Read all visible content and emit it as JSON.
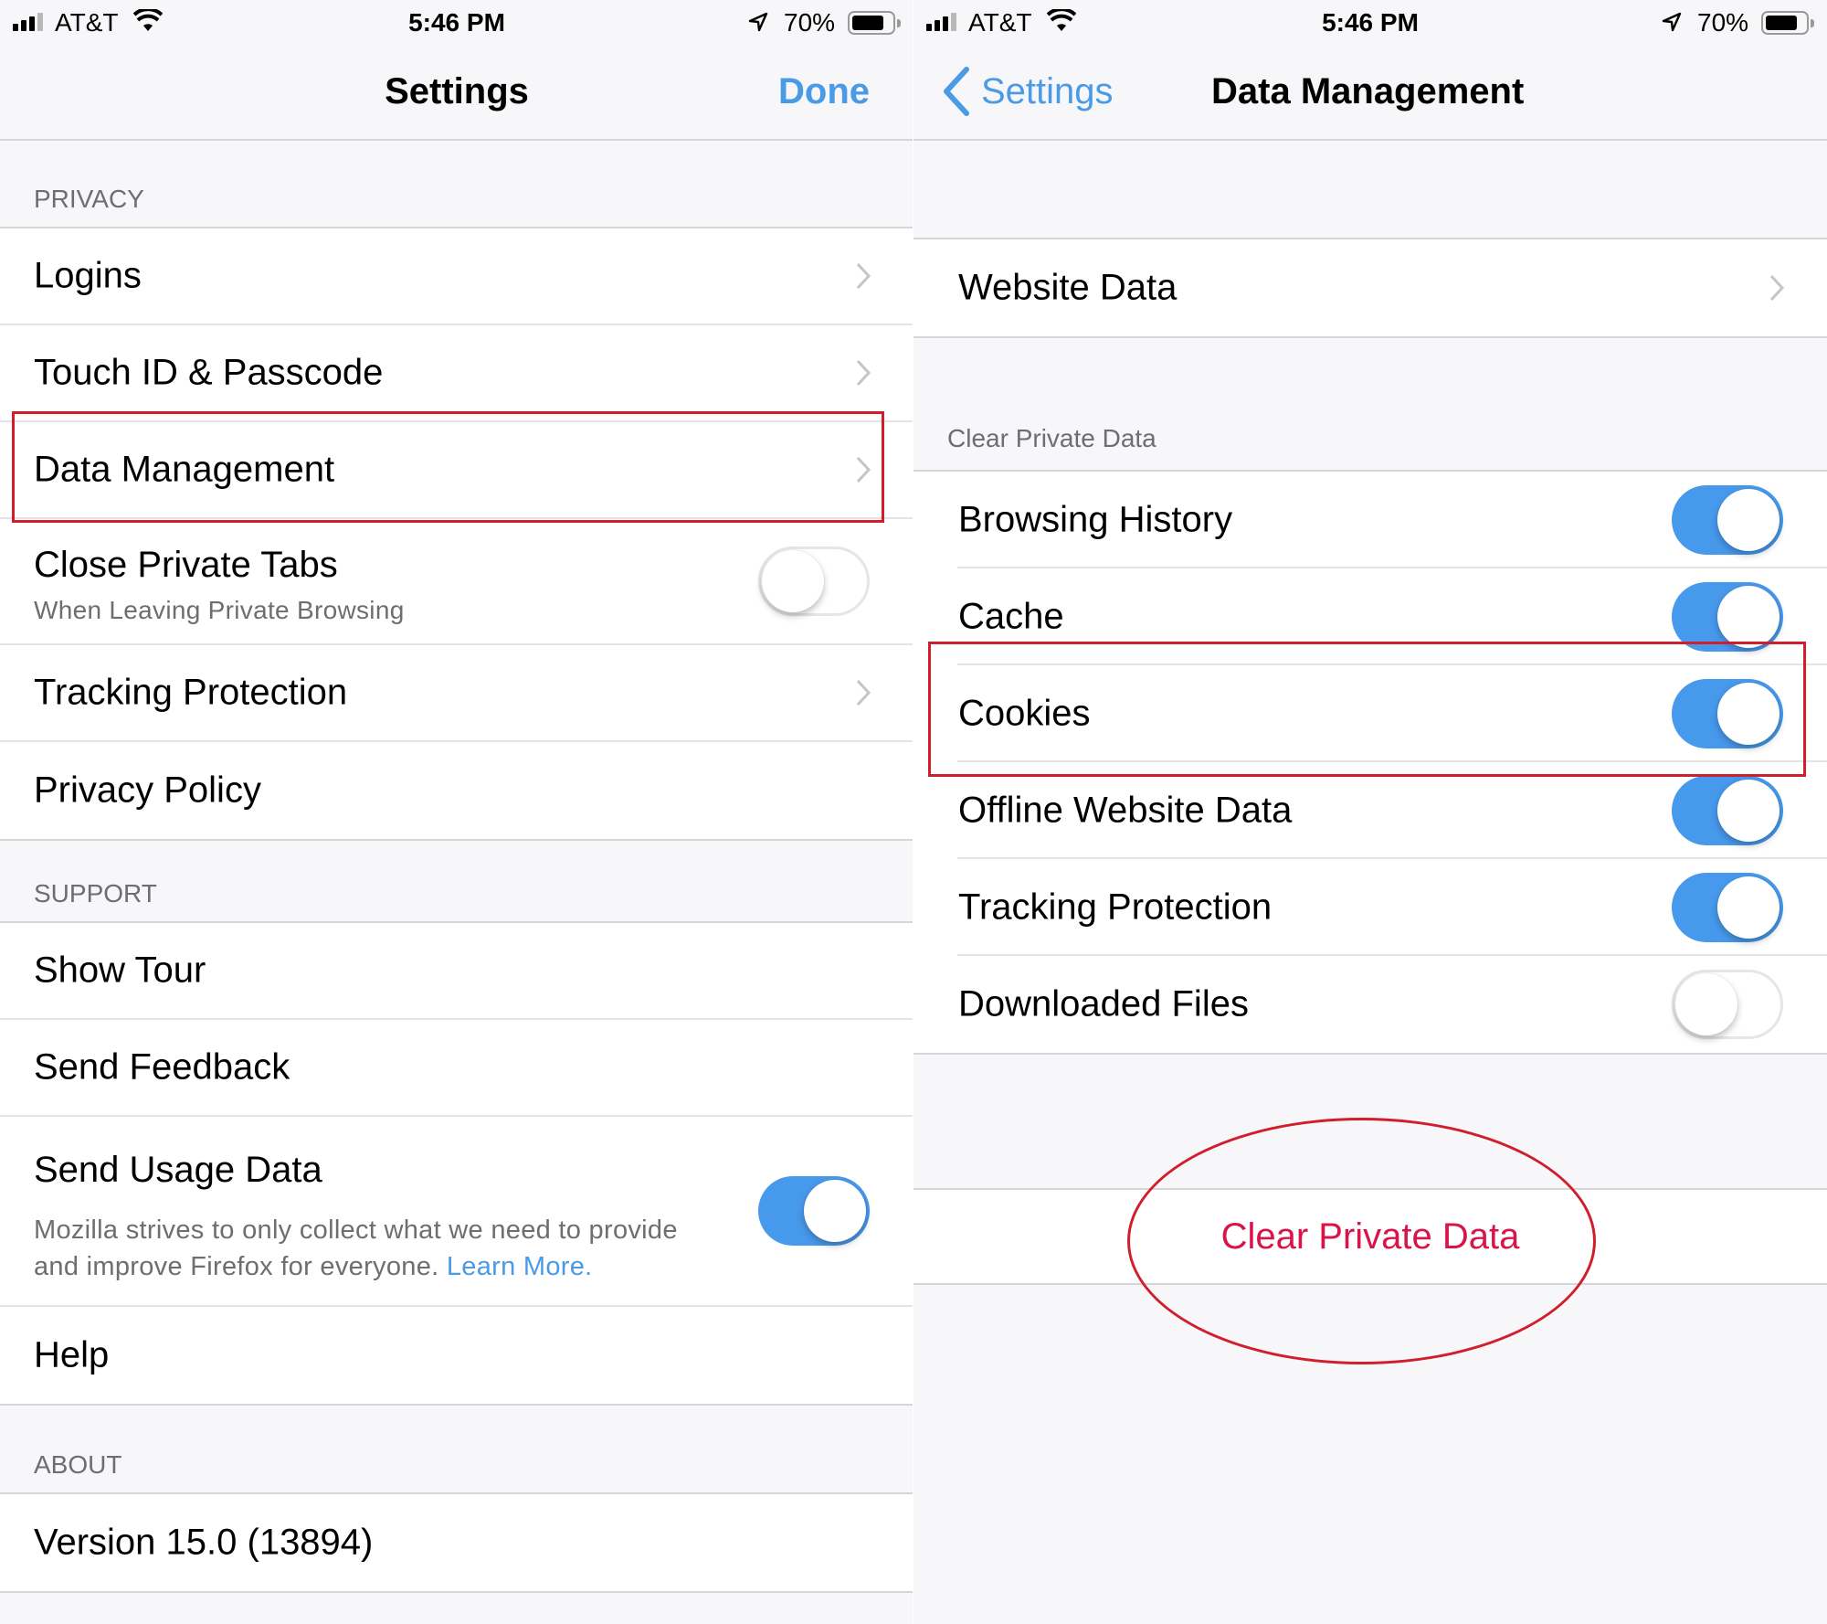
{
  "status_bar": {
    "carrier": "AT&T",
    "time": "5:46 PM",
    "battery_percent": "70%",
    "battery_level": 0.7,
    "signal_bars_on": 3,
    "signal_bars_total": 4
  },
  "left": {
    "nav": {
      "title": "Settings",
      "done_label": "Done"
    },
    "sections": [
      {
        "header": "PRIVACY",
        "rows": [
          {
            "label": "Logins",
            "type": "link"
          },
          {
            "label": "Touch ID & Passcode",
            "type": "link"
          },
          {
            "label": "Data Management",
            "type": "link",
            "highlighted": true
          },
          {
            "label": "Close Private Tabs",
            "sublabel": "When Leaving Private Browsing",
            "type": "toggle",
            "on": false
          },
          {
            "label": "Tracking Protection",
            "type": "link"
          },
          {
            "label": "Privacy Policy",
            "type": "plain"
          }
        ]
      },
      {
        "header": "SUPPORT",
        "rows": [
          {
            "label": "Show Tour",
            "type": "plain"
          },
          {
            "label": "Send Feedback",
            "type": "plain"
          },
          {
            "label": "Send Usage Data",
            "sublabel": "Mozilla strives to only collect what we need to provide and improve Firefox for everyone.",
            "link_text": "Learn More.",
            "type": "toggle",
            "on": true
          },
          {
            "label": "Help",
            "type": "plain"
          }
        ]
      },
      {
        "header": "ABOUT",
        "rows": [
          {
            "label": "Version 15.0 (13894)",
            "type": "plain"
          }
        ]
      }
    ]
  },
  "right": {
    "nav": {
      "back_label": "Settings",
      "title": "Data Management"
    },
    "website_data": {
      "label": "Website Data"
    },
    "clear_section": {
      "header": "Clear Private Data",
      "rows": [
        {
          "label": "Browsing History",
          "on": true
        },
        {
          "label": "Cache",
          "on": true
        },
        {
          "label": "Cookies",
          "on": true,
          "highlighted": true
        },
        {
          "label": "Offline Website Data",
          "on": true
        },
        {
          "label": "Tracking Protection",
          "on": true
        },
        {
          "label": "Downloaded Files",
          "on": false
        }
      ]
    },
    "clear_button": {
      "label": "Clear Private Data",
      "highlighted": true
    }
  },
  "colors": {
    "accent": "#4a9ae6",
    "toggle_on": "#4799ec",
    "destructive": "#d9144a",
    "annotation": "#d11e2c",
    "background": "#f7f7f9",
    "secondary_text": "#6d6d72"
  }
}
